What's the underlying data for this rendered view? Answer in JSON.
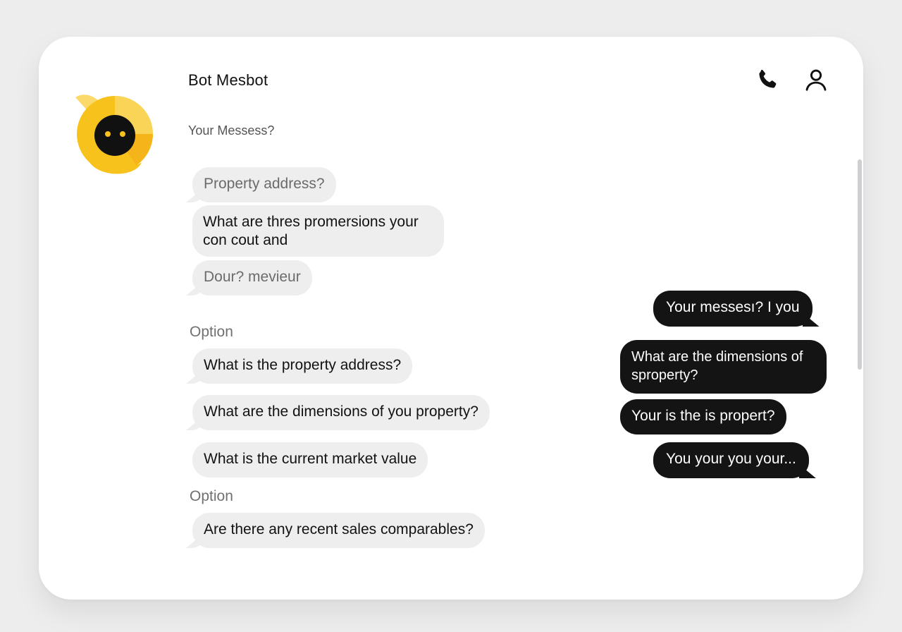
{
  "header": {
    "title": "Bot Mesbot",
    "subtitle": "Your Messess?",
    "icons": [
      "phone-icon",
      "user-icon"
    ]
  },
  "avatar": {
    "icon": "bot-avatar",
    "colors": {
      "primary": "#f7c21c",
      "light": "#fbd96a",
      "face": "#111111",
      "eyes": "#f7c21c"
    }
  },
  "bot_messages": [
    {
      "text": "Property address?"
    },
    {
      "text": "What are thres promersions your con cout and"
    },
    {
      "text": "Dour? mevieur"
    }
  ],
  "options_groups": [
    {
      "label": "Option",
      "items": [
        "What is the property address?",
        "What are the dimensions of you property?",
        "What is the current market value"
      ]
    },
    {
      "label": "Option",
      "items": [
        "Are there any recent sales comparables?"
      ]
    }
  ],
  "user_messages": [
    {
      "text": "Your messesı? I you"
    },
    {
      "text": "What are the dimensions of sproperty?"
    },
    {
      "text": "Your is the is propert?"
    },
    {
      "text": "You your you your..."
    }
  ],
  "colors": {
    "background": "#ededee",
    "card": "#ffffff",
    "bot_bubble": "#eeeeef",
    "user_bubble": "#141414"
  }
}
